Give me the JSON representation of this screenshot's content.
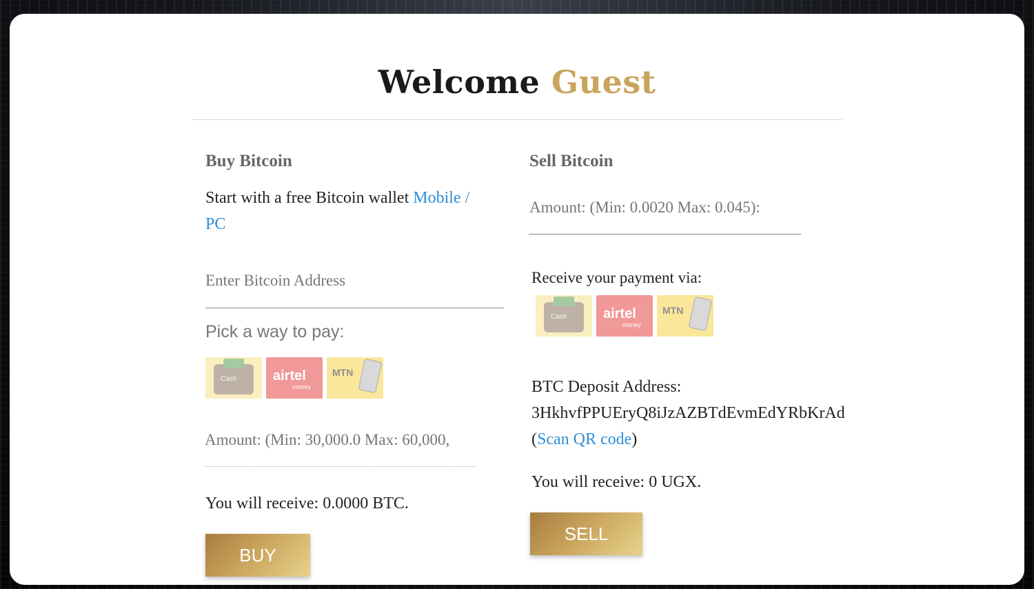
{
  "header": {
    "welcome": "Welcome",
    "user": "Guest"
  },
  "buy": {
    "title": "Buy Bitcoin",
    "intro": "Start with a free Bitcoin wallet",
    "link_mobile": "Mobile",
    "link_sep": "/",
    "link_pc": "PC",
    "address_placeholder": "Enter Bitcoin Address",
    "pick_label": "Pick a way to pay:",
    "amount_placeholder": "Amount: (Min: 30,000.0 Max: 60,000,",
    "receive_text": "You will receive: 0.0000 BTC.",
    "button": "BUY"
  },
  "sell": {
    "title": "Sell Bitcoin",
    "amount_placeholder": "Amount: (Min: 0.0020 Max: 0.045):",
    "receive_via": "Receive your payment via:",
    "deposit_label": "BTC Deposit Address:",
    "deposit_address": "3HkhvfPPUEryQ8iJzAZBTdEvmEdYRbKrAd",
    "scan_open": "(",
    "scan_link": "Scan QR code",
    "scan_close": ")",
    "receive_text": "You will receive: 0 UGX.",
    "button": "SELL"
  },
  "payment_methods": [
    {
      "name": "Cash",
      "icon": "cash-wallet-icon"
    },
    {
      "name": "airtel",
      "sub": "money",
      "icon": "airtel-money-icon"
    },
    {
      "name": "MTN",
      "icon": "mtn-mobile-money-icon"
    }
  ],
  "colors": {
    "accent": "#c9a45c",
    "link": "#2e8fd8"
  }
}
